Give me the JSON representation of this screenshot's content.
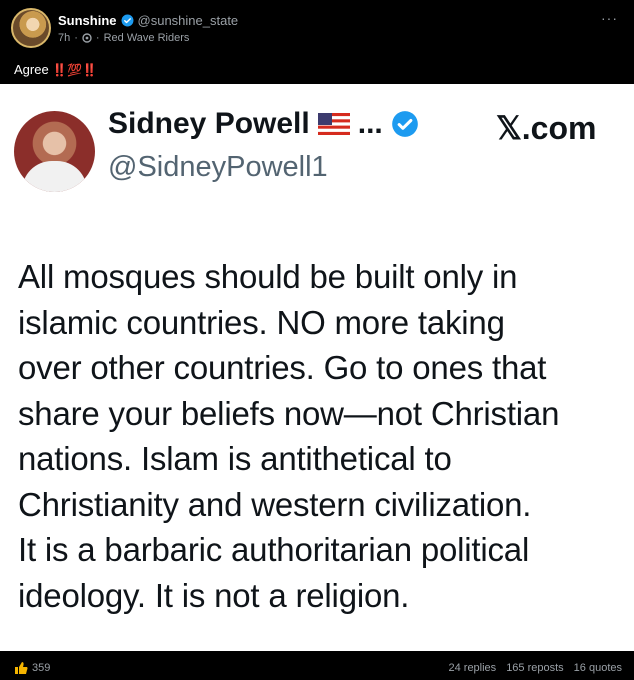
{
  "post": {
    "author_name": "Sunshine",
    "handle": "@sunshine_state",
    "time": "7h",
    "separator": "·",
    "community": "Red Wave Riders",
    "text": "Agree",
    "text_emoji": "‼️💯‼️",
    "more": "···"
  },
  "embedded_tweet": {
    "name": "Sidney Powell",
    "name_suffix": "...",
    "handle": "@SidneyPowell1",
    "source": "𝕏.com",
    "lines": [
      "All mosques should be built only in",
      "islamic countries. NO more taking",
      "over other countries. Go to ones that",
      "share your beliefs now—not Christian",
      "nations.  Islam is antithetical to",
      "Christianity and western civilization.",
      "It is a barbaric authoritarian political",
      "ideology. It is not a religion."
    ]
  },
  "footer": {
    "reaction_count": "359",
    "replies": "24 replies",
    "reposts": "165 reposts",
    "quotes": "16 quotes"
  },
  "colors": {
    "verified": "#1d9bf0",
    "background": "#000000",
    "card": "#ffffff"
  },
  "icons": [
    "verified-badge-icon",
    "community-icon",
    "us-flag-icon",
    "thumbs-up-icon",
    "more-icon"
  ]
}
